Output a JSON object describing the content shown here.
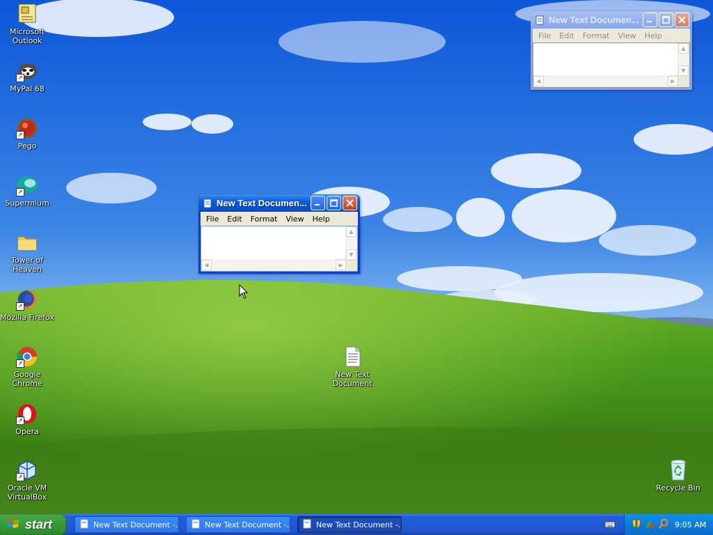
{
  "desktop": {
    "icons": [
      {
        "label": "Microsoft Outlook",
        "icon": "outlook-icon"
      },
      {
        "label": "MyPal 68",
        "icon": "mypal-icon"
      },
      {
        "label": "Pego",
        "icon": "pego-icon"
      },
      {
        "label": "Supermium",
        "icon": "supermium-icon"
      },
      {
        "label": "Tower of Heaven",
        "icon": "folder-icon"
      },
      {
        "label": "Mozilla Firefox",
        "icon": "firefox-icon"
      },
      {
        "label": "Google Chrome",
        "icon": "chrome-icon"
      },
      {
        "label": "Opera",
        "icon": "opera-icon"
      },
      {
        "label": "Oracle VM VirtualBox",
        "icon": "virtualbox-icon"
      },
      {
        "label": "New Text Document",
        "icon": "text-document-icon"
      },
      {
        "label": "Recycle Bin",
        "icon": "recycle-bin-icon"
      }
    ]
  },
  "windows": {
    "notepad_active": {
      "title": "New Text Documen...",
      "menu": [
        "File",
        "Edit",
        "Format",
        "View",
        "Help"
      ],
      "content": ""
    },
    "notepad_inactive": {
      "title": "New Text Documen...",
      "menu": [
        "File",
        "Edit",
        "Format",
        "View",
        "Help"
      ],
      "content": ""
    }
  },
  "taskbar": {
    "start_label": "start",
    "tasks": [
      {
        "label": "New Text Document -...",
        "active": false
      },
      {
        "label": "New Text Document -...",
        "active": false
      },
      {
        "label": "New Text Document -...",
        "active": true
      }
    ],
    "tray": {
      "icons": [
        "keyboard-icon",
        "security-shield-icon",
        "network-icon",
        "search-icon"
      ],
      "clock": "9:05 AM"
    }
  },
  "colors": {
    "taskbar_blue": "#245edb",
    "start_green": "#379937",
    "title_active": "#0a5fd8",
    "title_inactive": "#97b2ee"
  }
}
